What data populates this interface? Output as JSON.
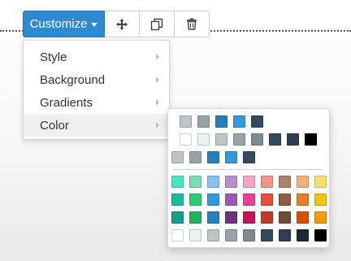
{
  "toolbar": {
    "customize_label": "Customize",
    "move_icon": "move-arrows-icon",
    "duplicate_icon": "duplicate-icon",
    "delete_icon": "trash-icon"
  },
  "menu": {
    "items": [
      {
        "label": "Style"
      },
      {
        "label": "Background"
      },
      {
        "label": "Gradients"
      },
      {
        "label": "Color"
      }
    ]
  },
  "palette": {
    "theme_rows": [
      [
        "#bdc3c7",
        "#95a5a6",
        "#2980b9",
        "#3498db",
        "#34495e"
      ],
      [
        "#ffffff",
        "#ecf0f1",
        "#bdc3c7",
        "#95a5a6",
        "#7f8c8d",
        "#34495e",
        "#2c3e50",
        "#000000"
      ],
      [
        "#bdc3c7",
        "#95a5a6",
        "#2980b9",
        "#3498db",
        "#34495e"
      ]
    ],
    "rows": [
      [
        "#48e5c2",
        "#7bdcb5",
        "#85c1e9",
        "#bb8fce",
        "#f5a3c7",
        "#f1948a",
        "#a9836a",
        "#f0b27a",
        "#f7dc6f"
      ],
      [
        "#1abc9c",
        "#2ecc71",
        "#3498db",
        "#9b59b6",
        "#e84393",
        "#e74c3c",
        "#8e5b43",
        "#e67e22",
        "#f1c40f"
      ],
      [
        "#16a085",
        "#27ae60",
        "#2980b9",
        "#6c3483",
        "#c2185b",
        "#c0392b",
        "#6e4b3a",
        "#d35400",
        "#f39c12"
      ],
      [
        "#ffffff",
        "#ecf0f1",
        "#bdc3c7",
        "#95a5a6",
        "#7f8c8d",
        "#34495e",
        "#2c3e50",
        "#1c2833",
        "#000000"
      ]
    ]
  }
}
